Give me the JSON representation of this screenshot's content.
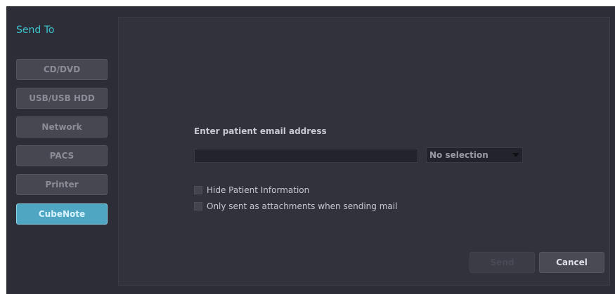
{
  "dialog": {
    "title": "Send To"
  },
  "nav": {
    "items": [
      {
        "label": "CD/DVD",
        "active": false
      },
      {
        "label": "USB/USB HDD",
        "active": false
      },
      {
        "label": "Network",
        "active": false
      },
      {
        "label": "PACS",
        "active": false
      },
      {
        "label": "Printer",
        "active": false
      },
      {
        "label": "CubeNote",
        "active": true
      }
    ]
  },
  "form": {
    "email_label": "Enter patient email address",
    "email_value": "",
    "email_placeholder": "",
    "select_value": "No selection",
    "checkboxes": [
      {
        "label": "Hide Patient Information",
        "checked": false
      },
      {
        "label": "Only sent as attachments when sending mail",
        "checked": false
      }
    ]
  },
  "buttons": {
    "send_label": "Send",
    "cancel_label": "Cancel",
    "send_enabled": false
  },
  "colors": {
    "title": "#3ec3cf",
    "active_nav": "#4fa6c2",
    "background": "#2d2d37"
  }
}
